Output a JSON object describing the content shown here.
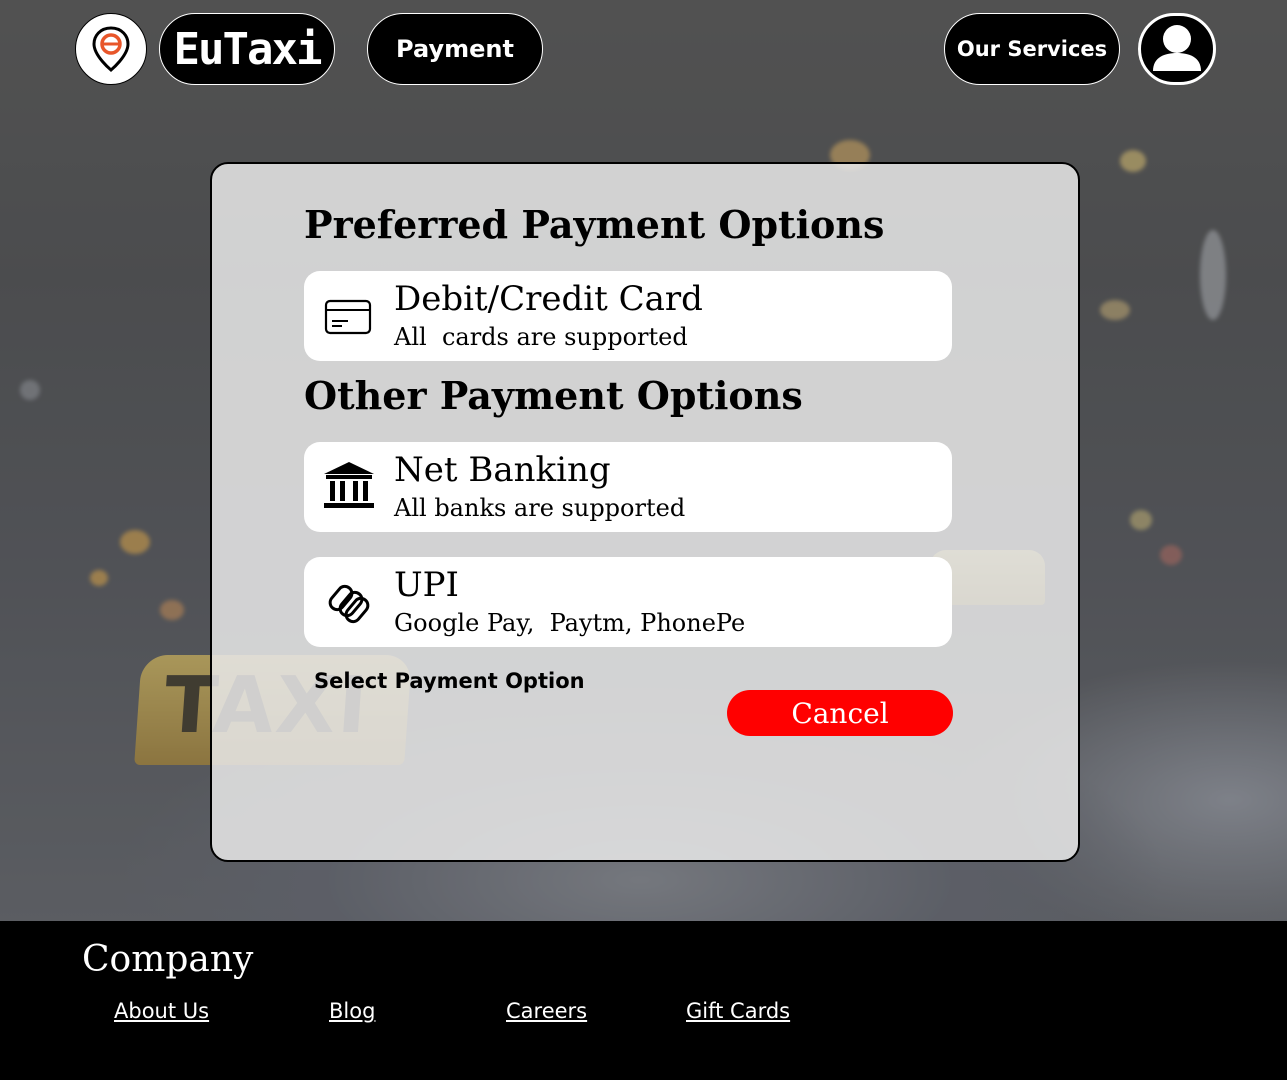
{
  "header": {
    "brand": "EuTaxi",
    "payment_label": "Payment",
    "services_label": "Our Services"
  },
  "background": {
    "taxi_sign_text": "TAXI"
  },
  "modal": {
    "preferred_title": "Preferred Payment Options",
    "other_title": "Other Payment  Options",
    "options": [
      {
        "title": "Debit/Credit Card",
        "subtitle": "All  cards are supported",
        "icon": "credit-card-icon"
      },
      {
        "title": "Net Banking",
        "subtitle": "All banks are supported",
        "icon": "bank-icon"
      },
      {
        "title": "UPI",
        "subtitle": "Google Pay,  Paytm, PhonePe",
        "icon": "upi-icon"
      }
    ],
    "select_label": "Select Payment Option",
    "cancel_label": "Cancel"
  },
  "footer": {
    "company_title": "Company",
    "links": [
      "About Us",
      "Blog",
      "Careers",
      "Gift Cards"
    ]
  },
  "colors": {
    "accent": "#ff0000",
    "header_bg": "#000000",
    "logo_orange": "#e8562a"
  }
}
